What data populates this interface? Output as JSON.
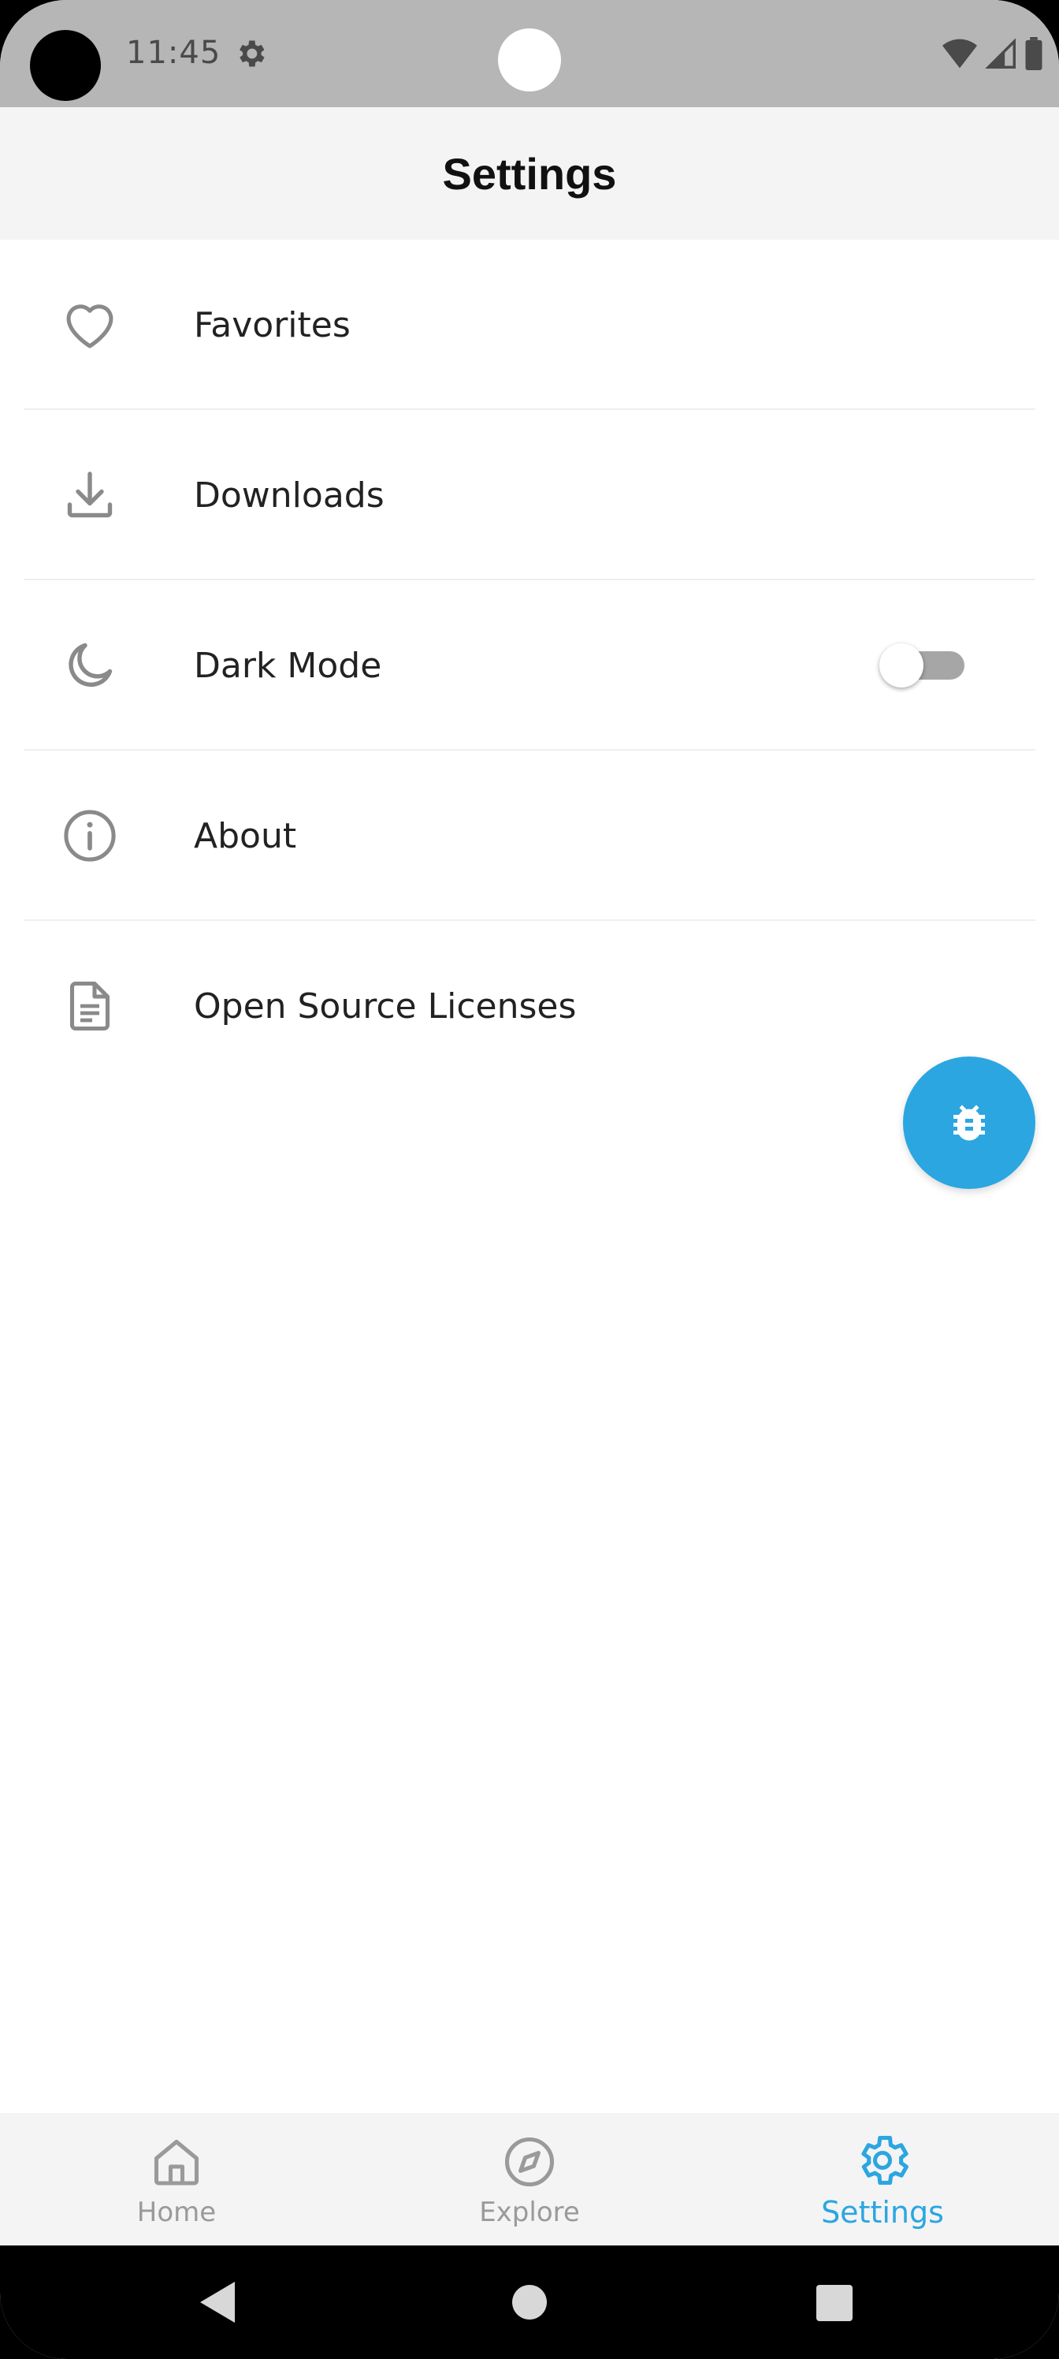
{
  "status_bar": {
    "time": "11:45",
    "icons": [
      "settings-gear-icon",
      "wifi-icon",
      "cell-signal-icon",
      "battery-icon"
    ]
  },
  "header": {
    "title": "Settings"
  },
  "settings": {
    "items": [
      {
        "label": "Favorites",
        "icon": "heart-icon"
      },
      {
        "label": "Downloads",
        "icon": "download-icon"
      },
      {
        "label": "Dark Mode",
        "icon": "moon-icon",
        "toggle": false
      },
      {
        "label": "About",
        "icon": "info-icon"
      },
      {
        "label": "Open Source Licenses",
        "icon": "document-icon"
      }
    ]
  },
  "fab": {
    "icon": "bug-icon"
  },
  "bottom_nav": {
    "items": [
      {
        "label": "Home",
        "icon": "home-icon",
        "active": false
      },
      {
        "label": "Explore",
        "icon": "compass-icon",
        "active": false
      },
      {
        "label": "Settings",
        "icon": "gear-icon",
        "active": true
      }
    ]
  },
  "colors": {
    "accent": "#2ba6e1",
    "icon_gray": "#8a8a8a",
    "header_bg": "#f4f4f4",
    "status_bar_bg": "#b6b6b6"
  }
}
